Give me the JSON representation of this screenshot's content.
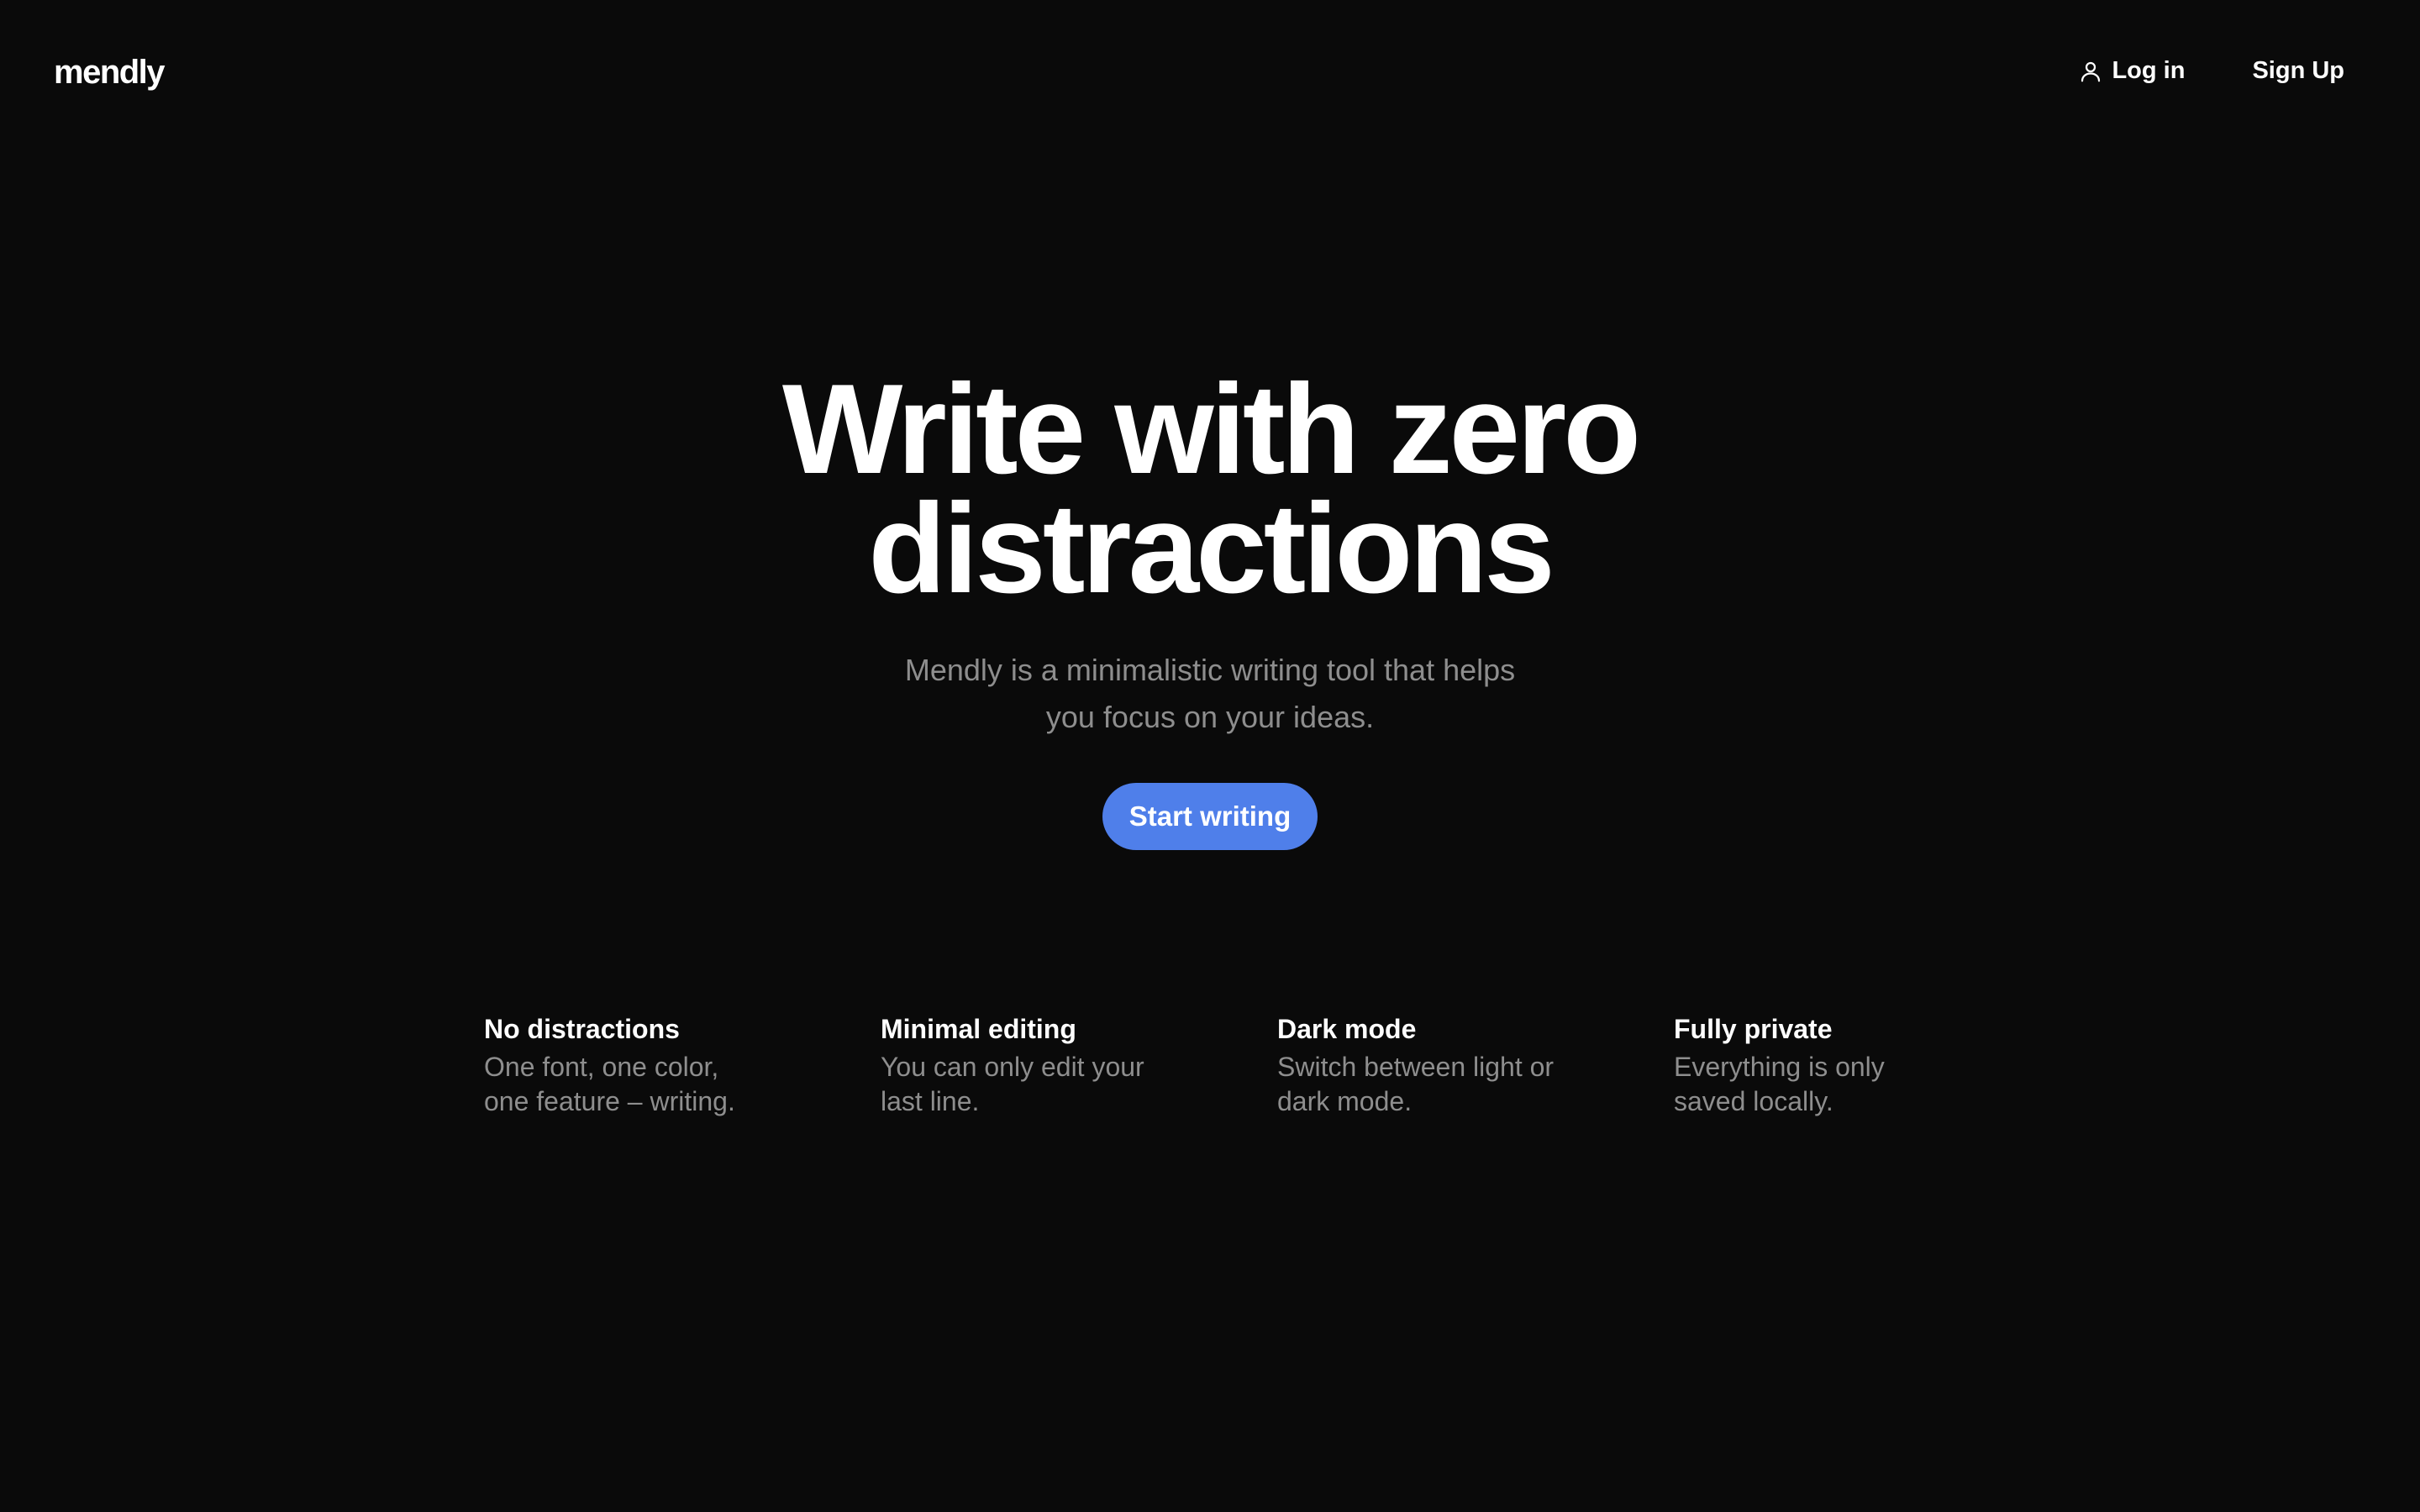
{
  "header": {
    "logo": "mendly",
    "login_icon": "user-icon",
    "login_label": "Log in",
    "signup_label": "Sign Up"
  },
  "hero": {
    "title": "Write with zero distractions",
    "subtitle": "Mendly is a minimalistic writing tool that helps you focus on your ideas.",
    "cta_label": "Start writing"
  },
  "features": [
    {
      "title": "No distractions",
      "description": "One font, one color, one feature – writing."
    },
    {
      "title": "Minimal editing",
      "description": "You can only edit your last line."
    },
    {
      "title": "Dark mode",
      "description": "Switch between light or dark mode."
    },
    {
      "title": "Fully private",
      "description": "Everything is only saved locally."
    }
  ],
  "colors": {
    "background": "#0a0a0a",
    "text": "#ffffff",
    "muted_text": "#8e8e8e",
    "accent": "#4f7fea"
  }
}
